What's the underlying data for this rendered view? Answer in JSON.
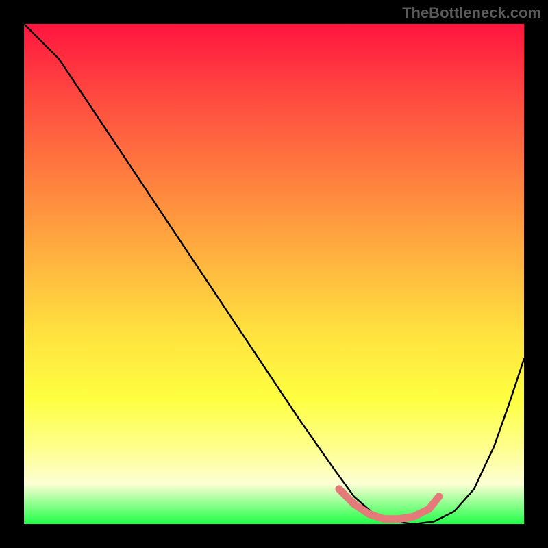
{
  "watermark": "TheBottleneck.com",
  "chart_data": {
    "type": "line",
    "title": "",
    "xlabel": "",
    "ylabel": "",
    "xlim": [
      0,
      1
    ],
    "ylim": [
      0,
      1
    ],
    "series": [
      {
        "name": "bottleneck-curve",
        "x": [
          0.0,
          0.03,
          0.07,
          0.15,
          0.25,
          0.35,
          0.45,
          0.55,
          0.62,
          0.66,
          0.7,
          0.74,
          0.78,
          0.82,
          0.86,
          0.9,
          0.94,
          0.97,
          1.0
        ],
        "y": [
          1.0,
          0.97,
          0.93,
          0.81,
          0.66,
          0.51,
          0.36,
          0.21,
          0.11,
          0.055,
          0.02,
          0.005,
          0.0,
          0.005,
          0.025,
          0.07,
          0.155,
          0.24,
          0.33
        ],
        "color": "#000000"
      },
      {
        "name": "sweet-spot-band",
        "x": [
          0.63,
          0.66,
          0.69,
          0.72,
          0.75,
          0.78,
          0.81,
          0.83
        ],
        "y": [
          0.07,
          0.04,
          0.02,
          0.01,
          0.01,
          0.015,
          0.03,
          0.055
        ],
        "color": "#e47a7a"
      }
    ],
    "background_gradient": {
      "stops": [
        {
          "pos": 0.0,
          "color": "#ff153f"
        },
        {
          "pos": 0.14,
          "color": "#ff4840"
        },
        {
          "pos": 0.3,
          "color": "#ff7c3f"
        },
        {
          "pos": 0.46,
          "color": "#ffb03f"
        },
        {
          "pos": 0.62,
          "color": "#ffe23f"
        },
        {
          "pos": 0.75,
          "color": "#feff40"
        },
        {
          "pos": 0.85,
          "color": "#feff8f"
        },
        {
          "pos": 0.92,
          "color": "#fcffd4"
        },
        {
          "pos": 1.0,
          "color": "#20ff47"
        }
      ]
    }
  }
}
